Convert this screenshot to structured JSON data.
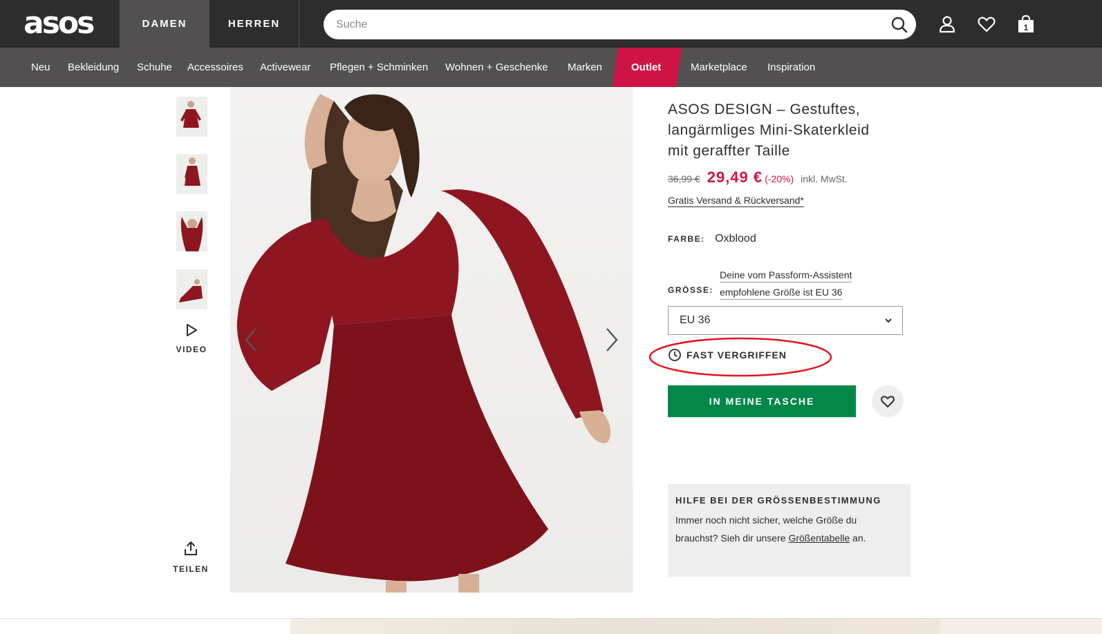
{
  "header": {
    "logo": "asos",
    "tabs": [
      {
        "label": "DAMEN",
        "active": true
      },
      {
        "label": "HERREN",
        "active": false
      }
    ],
    "search": {
      "placeholder": "Suche",
      "value": ""
    },
    "bag_count": "1",
    "icons": [
      "search-icon",
      "account-icon",
      "heart-icon",
      "bag-icon"
    ]
  },
  "nav": {
    "items": [
      "Neu",
      "Bekleidung",
      "Schuhe",
      "Accessoires",
      "Activewear",
      "Pflegen + Schminken",
      "Wohnen + Geschenke",
      "Marken",
      "Outlet",
      "Marketplace",
      "Inspiration"
    ]
  },
  "gallery": {
    "video_label": "VIDEO",
    "share_label": "TEILEN"
  },
  "product": {
    "title": "ASOS DESIGN – Gestuftes, langärmliges Mini-Skaterkleid mit geraffter Taille",
    "old_price": "36,99 €",
    "price": "29,49 €",
    "discount": "(-20%)",
    "vat": "inkl. MwSt.",
    "shipping": "Gratis Versand & Rückversand*",
    "colour_label": "FARBE:",
    "colour": "Oxblood",
    "fit_hint_line1": "Deine vom Passform-Assistent",
    "fit_hint_line2": "empfohlene Größe ist EU 36",
    "size_label": "GRÖSSE:",
    "size_selected": "EU 36",
    "stock_status": "FAST VERGRIFFEN",
    "add_to_bag": "IN MEINE TASCHE"
  },
  "size_help": {
    "heading": "HILFE BEI DER GRÖSSENBESTIMMUNG",
    "text_before": "Immer noch nicht sicher, welche Größe du brauchst? Sieh dir unsere ",
    "link": "Größentabelle",
    "text_after": " an."
  },
  "colors": {
    "topbar": "#2d2d2d",
    "nav": "#525050",
    "outlet": "#d01345",
    "sale_price": "#d01345",
    "add_to_bag": "#018849",
    "annotation": "#e3141b",
    "dress": "#8e1620"
  }
}
